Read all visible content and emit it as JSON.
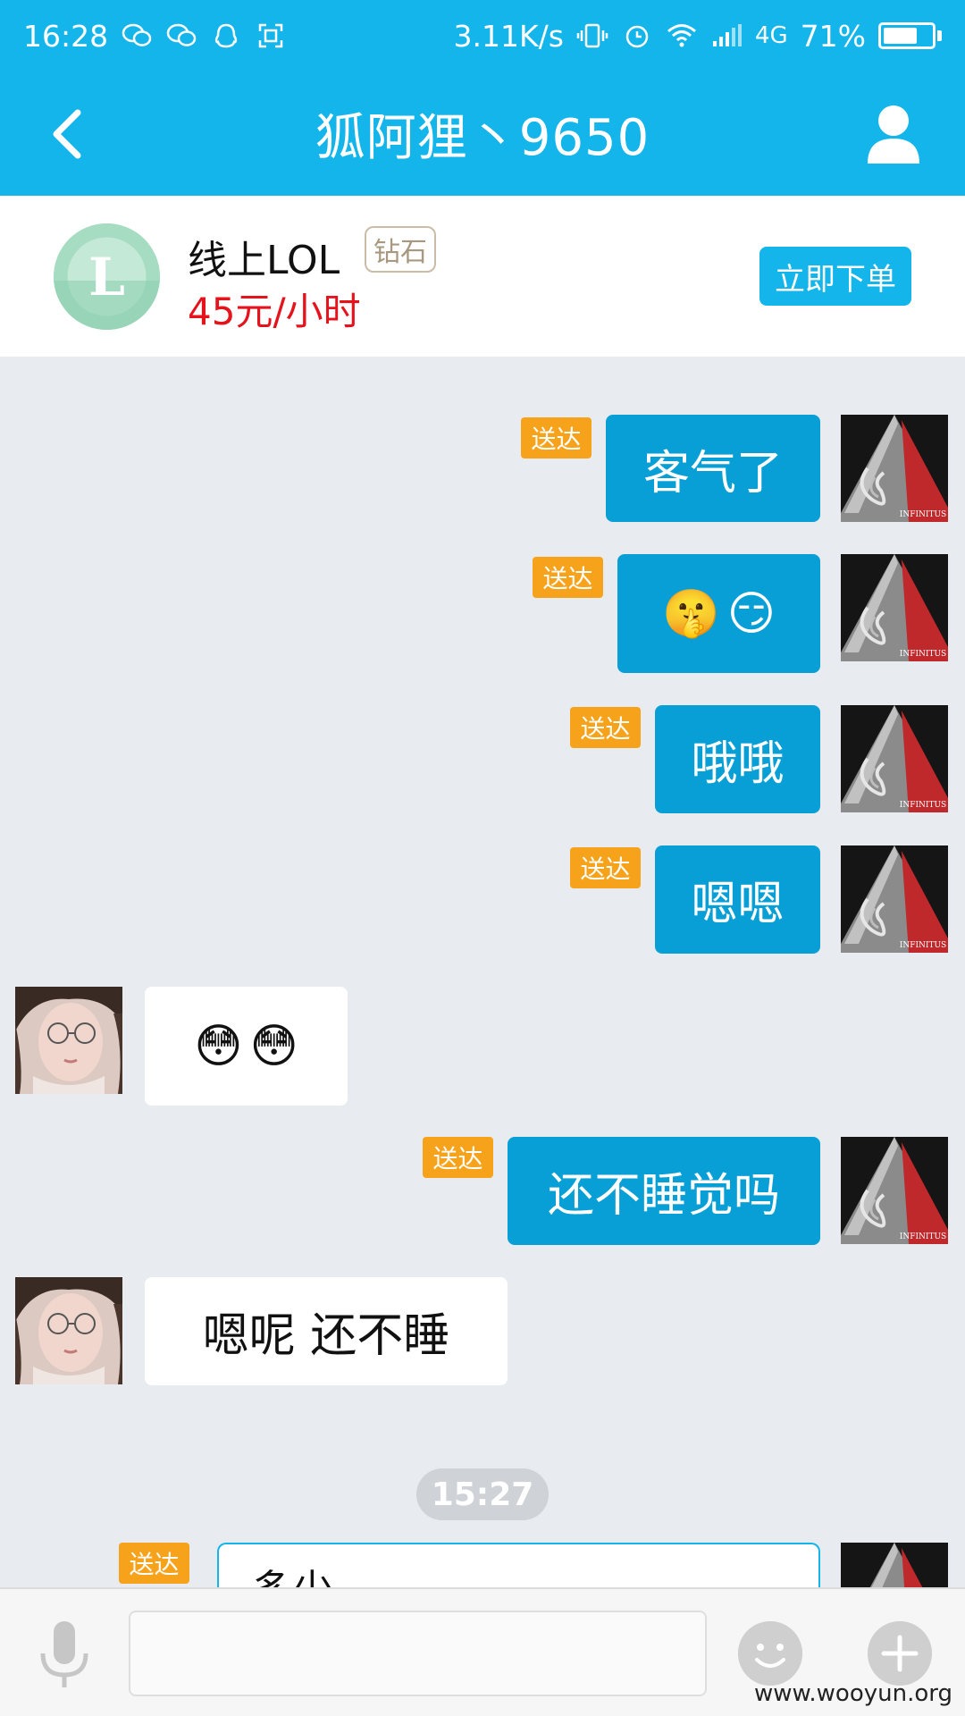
{
  "status_bar": {
    "time": "16:28",
    "net_speed": "3.11K/s",
    "network": "4G",
    "battery_percent": "71%",
    "battery_level": 0.71,
    "left_icons": [
      "wechat-icon",
      "wechat-icon",
      "qq-icon",
      "screenshot-icon"
    ],
    "right_icons": [
      "vibrate-icon",
      "alarm-icon",
      "wifi-icon",
      "signal-icon"
    ]
  },
  "header": {
    "title": "狐阿狸丶9650",
    "back_icon": "chevron-left-icon",
    "profile_icon": "person-icon"
  },
  "product": {
    "logo_letter": "L",
    "name": "线上LOL",
    "rank_badge": "钻石",
    "price": "45元/小时",
    "order_button": "立即下单"
  },
  "messages": [
    {
      "side": "self",
      "type": "text",
      "text": "客气了",
      "status": "送达"
    },
    {
      "side": "self",
      "type": "emoji",
      "emojis": [
        "🤫",
        "😏"
      ],
      "status": "送达"
    },
    {
      "side": "self",
      "type": "text",
      "text": "哦哦",
      "status": "送达"
    },
    {
      "side": "self",
      "type": "text",
      "text": "嗯嗯",
      "status": "送达"
    },
    {
      "side": "peer",
      "type": "emoji",
      "emojis": [
        "😳",
        "😳"
      ]
    },
    {
      "side": "self",
      "type": "text",
      "text": "还不睡觉吗",
      "status": "送达"
    },
    {
      "side": "peer",
      "type": "text",
      "text": "嗯呢 还不睡"
    }
  ],
  "timestamp": "15:27",
  "partial_message": {
    "side": "self",
    "text": "多少",
    "status": "送达"
  },
  "avatar_self_text": "INFINITUS",
  "input_bar": {
    "placeholder": "",
    "mic_icon": "microphone-icon",
    "emoji_icon": "smiley-icon",
    "plus_icon": "plus-icon"
  },
  "watermark": "www.wooyun.org",
  "colors": {
    "brand": "#13b5ea",
    "self_bubble": "#079fd5",
    "sent_tag": "#f7a21b",
    "price": "#e5141c",
    "background": "#e8ebf0"
  }
}
